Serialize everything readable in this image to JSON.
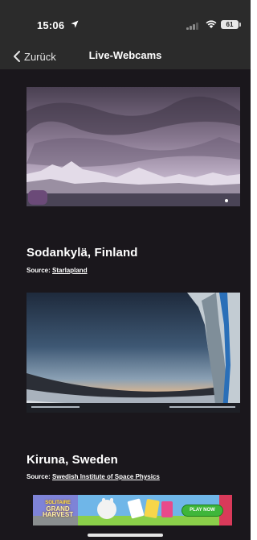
{
  "status_bar": {
    "time": "15:06",
    "battery": "61"
  },
  "nav": {
    "back_label": "Zurück",
    "title": "Live-Webcams"
  },
  "webcams": [
    {
      "title": "Sodankylä, Finland",
      "source_prefix": "Source: ",
      "source_link": "Starlapland"
    },
    {
      "title": "Kiruna, Sweden",
      "source_prefix": "Source: ",
      "source_link": "Swedish Institute of Space Physics"
    }
  ],
  "ad": {
    "line1": "SOLITAIRE",
    "line2": "GRAND",
    "line3": "HARVEST",
    "cta": "PLAY NOW"
  },
  "colors": {
    "background": "#1a171c",
    "bars": "#2b2b2b",
    "text": "#ffffff"
  }
}
